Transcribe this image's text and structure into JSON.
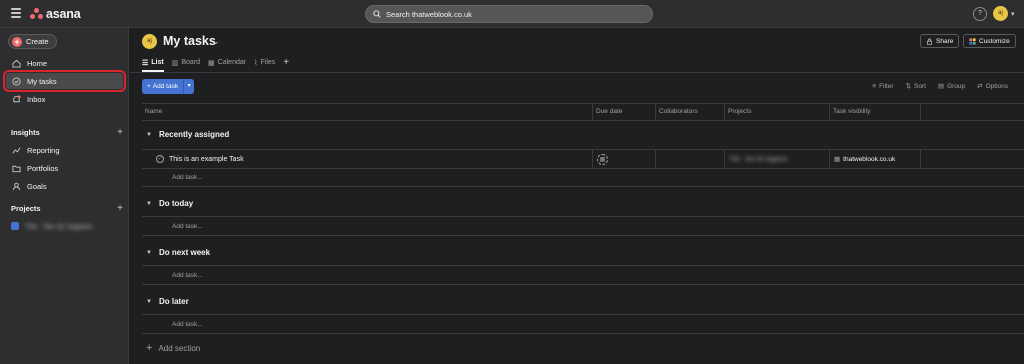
{
  "topbar": {
    "logo_text": "asana",
    "search_placeholder": "Search thatweblook.co.uk",
    "help_label": "?",
    "user_initials": "aj"
  },
  "sidebar": {
    "create_label": "Create",
    "nav": [
      {
        "label": "Home",
        "icon": "home-icon"
      },
      {
        "label": "My tasks",
        "icon": "check-circle-icon",
        "active": true
      },
      {
        "label": "Inbox",
        "icon": "bell-icon"
      }
    ],
    "insights": {
      "title": "Insights",
      "items": [
        {
          "label": "Reporting",
          "icon": "chart-line-icon"
        },
        {
          "label": "Portfolios",
          "icon": "folder-icon"
        },
        {
          "label": "Goals",
          "icon": "person-icon"
        }
      ]
    },
    "projects": {
      "title": "Projects",
      "items": [
        {
          "label": "TW - Ten ID Saplom",
          "color": "#4573d2",
          "blurred": true
        }
      ]
    }
  },
  "header": {
    "user_initials": "aj",
    "title": "My tasks",
    "share_label": "Share",
    "customize_label": "Customize",
    "tabs": [
      {
        "label": "List",
        "icon": "list-icon",
        "active": true
      },
      {
        "label": "Board",
        "icon": "board-icon"
      },
      {
        "label": "Calendar",
        "icon": "calendar-icon"
      },
      {
        "label": "Files",
        "icon": "paperclip-icon"
      }
    ]
  },
  "toolbar": {
    "add_task_label": "Add task",
    "filter_label": "Filter",
    "sort_label": "Sort",
    "group_label": "Group",
    "options_label": "Options"
  },
  "table": {
    "columns": [
      "Name",
      "Due date",
      "Collaborators",
      "Projects",
      "Task visibility"
    ],
    "sections": [
      {
        "title": "Recently assigned",
        "tasks": [
          {
            "name": "This is an example Task",
            "project": "TW - Ten ID Saplom",
            "visibility": "thatweblook.co.uk"
          }
        ]
      },
      {
        "title": "Do today",
        "tasks": []
      },
      {
        "title": "Do next week",
        "tasks": []
      },
      {
        "title": "Do later",
        "tasks": []
      }
    ],
    "add_task_text": "Add task...",
    "add_section_text": "Add section"
  },
  "colors": {
    "accent_blue": "#4573d2",
    "brand_coral": "#f06a6a",
    "highlight_red": "#d9262c"
  }
}
